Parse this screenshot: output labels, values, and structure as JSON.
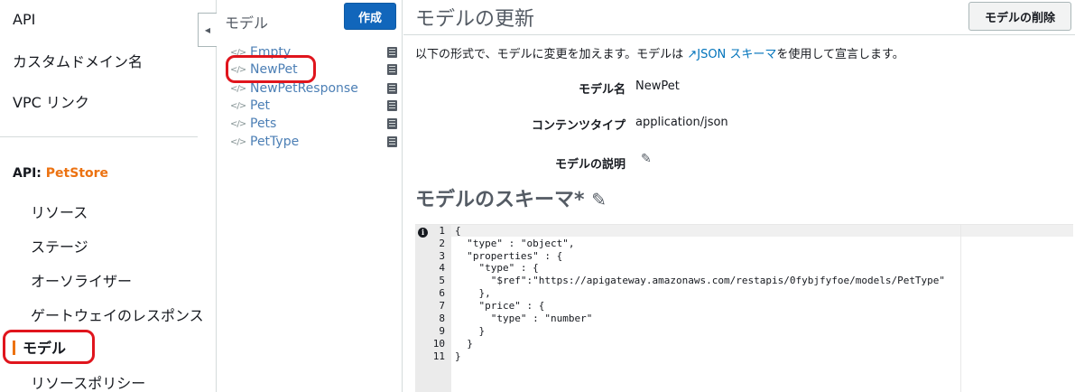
{
  "nav": {
    "top_items": [
      "API",
      "カスタムドメイン名",
      "VPC リンク"
    ],
    "api_prefix": "API: ",
    "api_name": "PetStore",
    "sub_items": [
      "リソース",
      "ステージ",
      "オーソライザー",
      "ゲートウェイのレスポンス"
    ],
    "active_item": "モデル",
    "last_item": "リソースポリシー"
  },
  "models": {
    "title": "モデル",
    "create_label": "作成",
    "items": [
      "Empty",
      "NewPet",
      "NewPetResponse",
      "Pet",
      "Pets",
      "PetType"
    ]
  },
  "main": {
    "title": "モデルの更新",
    "delete_label": "モデルの削除",
    "desc_prefix": "以下の形式で、モデルに変更を加えます。モデルは ",
    "desc_link": "JSON スキーマ",
    "desc_suffix": "を使用して宣言します。",
    "fields": {
      "name_label": "モデル名",
      "name_value": "NewPet",
      "content_type_label": "コンテンツタイプ",
      "content_type_value": "application/json",
      "description_label": "モデルの説明"
    },
    "schema_title": "モデルのスキーマ*"
  },
  "editor": {
    "line_numbers": [
      "1",
      "2",
      "3",
      "4",
      "5",
      "6",
      "7",
      "8",
      "9",
      "10",
      "11"
    ],
    "lines": [
      "{",
      "  \"type\" : \"object\",",
      "  \"properties\" : {",
      "    \"type\" : {",
      "      \"$ref\":\"https://apigateway.amazonaws.com/restapis/0fybjfyfoe/models/PetType\"",
      "    },",
      "    \"price\" : {",
      "      \"type\" : \"number\"",
      "    }",
      "  }",
      "}"
    ]
  },
  "icons": {
    "collapse": "chevron-left-icon",
    "model_code": "code-icon",
    "model_doc": "book-icon",
    "external_link": "external-link-icon",
    "edit": "pencil-icon",
    "info": "info-icon"
  },
  "colors": {
    "accent": "#ec7211",
    "primary_button": "#1166bb",
    "link": "#4c7fb5",
    "highlight_ring": "#e0151d"
  }
}
